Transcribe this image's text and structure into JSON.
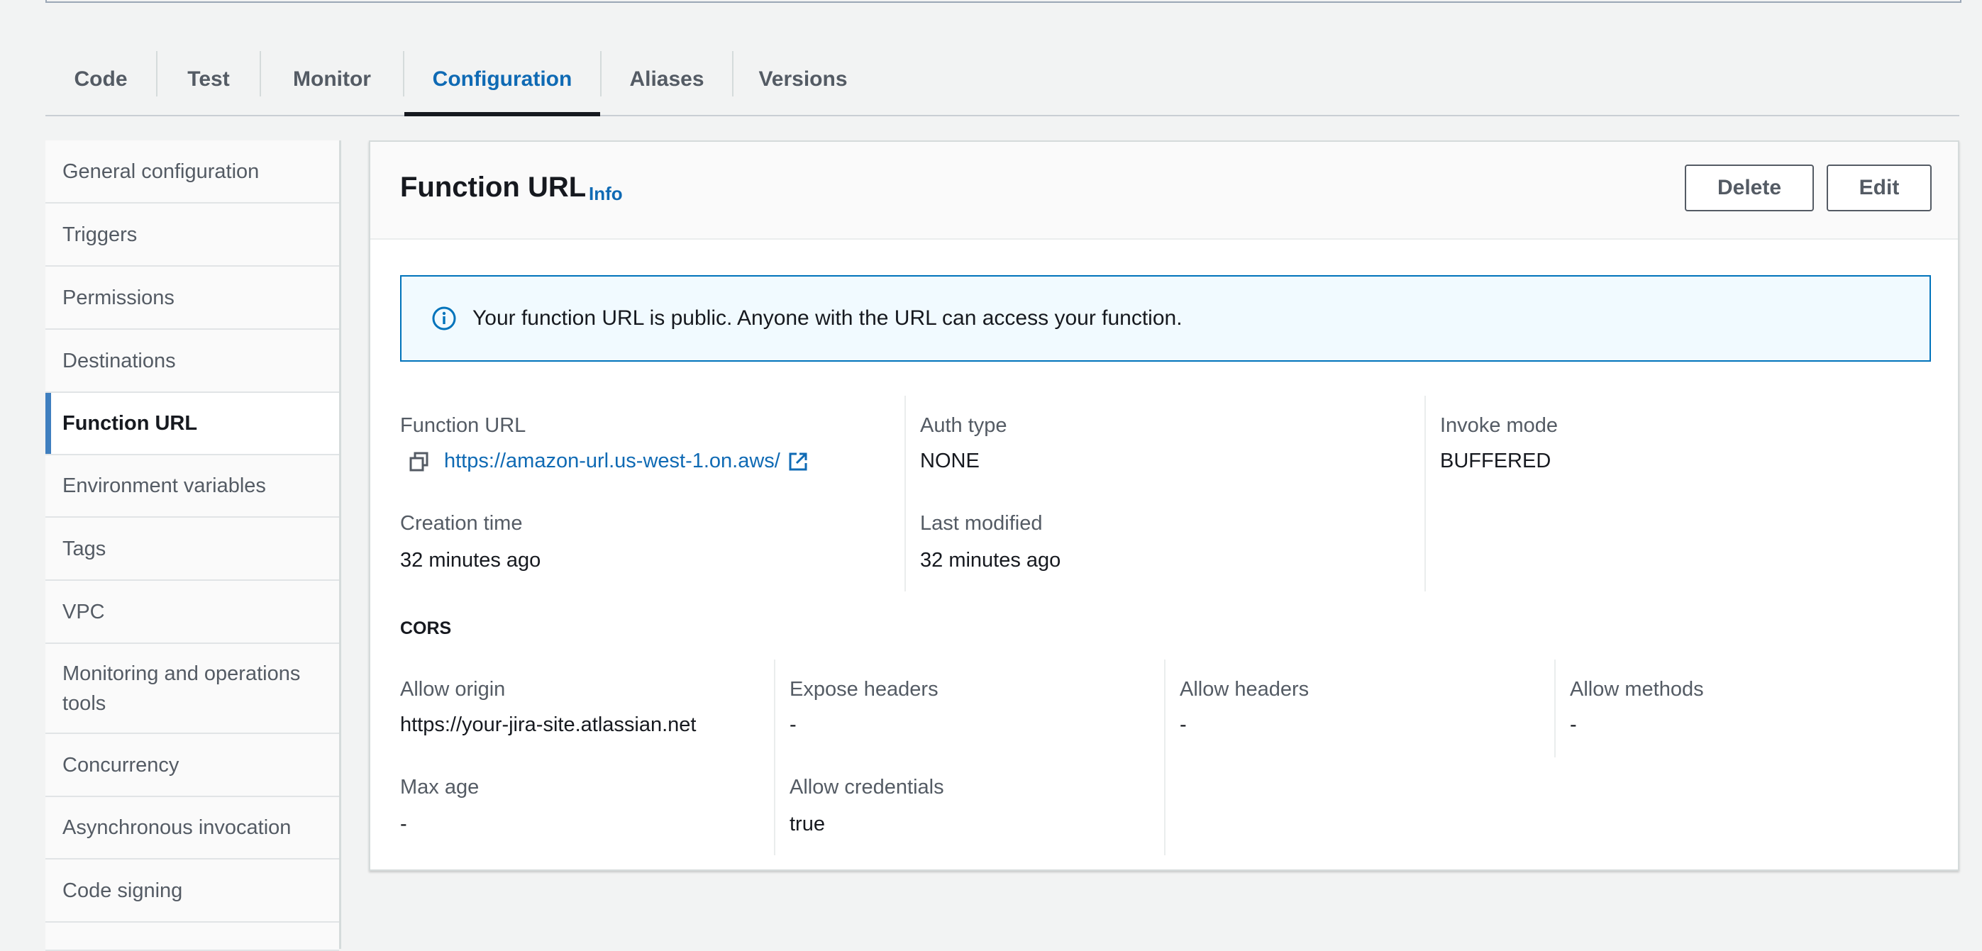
{
  "tabs": [
    {
      "label": "Code"
    },
    {
      "label": "Test"
    },
    {
      "label": "Monitor"
    },
    {
      "label": "Configuration"
    },
    {
      "label": "Aliases"
    },
    {
      "label": "Versions"
    }
  ],
  "active_tab": "Configuration",
  "sidebar": {
    "items": [
      {
        "label": "General configuration"
      },
      {
        "label": "Triggers"
      },
      {
        "label": "Permissions"
      },
      {
        "label": "Destinations"
      },
      {
        "label": "Function URL"
      },
      {
        "label": "Environment variables"
      },
      {
        "label": "Tags"
      },
      {
        "label": "VPC"
      },
      {
        "label": "Monitoring and operations tools"
      },
      {
        "label": "Concurrency"
      },
      {
        "label": "Asynchronous invocation"
      },
      {
        "label": "Code signing"
      }
    ],
    "active": "Function URL"
  },
  "panel": {
    "title": "Function URL",
    "info": "Info",
    "delete_label": "Delete",
    "edit_label": "Edit",
    "alert": "Your function URL is public. Anyone with the URL can access your function.",
    "details": {
      "function_url_label": "Function URL",
      "function_url_value": "https://amazon-url.us-west-1.on.aws/",
      "auth_type_label": "Auth type",
      "auth_type_value": "NONE",
      "invoke_mode_label": "Invoke mode",
      "invoke_mode_value": "BUFFERED",
      "creation_time_label": "Creation time",
      "creation_time_value": "32 minutes ago",
      "last_modified_label": "Last modified",
      "last_modified_value": "32 minutes ago"
    },
    "cors": {
      "title": "CORS",
      "allow_origin_label": "Allow origin",
      "allow_origin_value": "https://your-jira-site.atlassian.net",
      "expose_headers_label": "Expose headers",
      "expose_headers_value": "-",
      "allow_headers_label": "Allow headers",
      "allow_headers_value": "-",
      "allow_methods_label": "Allow methods",
      "allow_methods_value": "-",
      "max_age_label": "Max age",
      "max_age_value": "-",
      "allow_credentials_label": "Allow credentials",
      "allow_credentials_value": "true"
    }
  },
  "colors": {
    "accent": "#0f6ab4",
    "active_indicator": "#3f7fbf",
    "alert_border": "#0073bb",
    "alert_bg": "#f1faff"
  },
  "icons": {
    "copy": "copy-icon",
    "external_link": "external-link-icon",
    "info": "info-circle-icon"
  }
}
